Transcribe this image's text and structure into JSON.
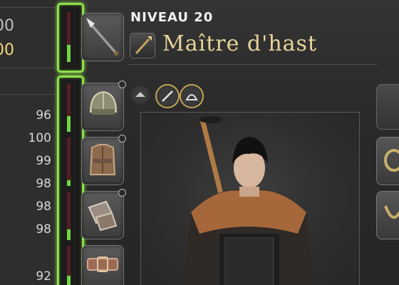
{
  "header": {
    "level_text": "NIVEAU 20",
    "job_name": "Maître d'hast"
  },
  "left_stats": {
    "partial_top": "00",
    "partial_bottom": "00",
    "item_levels": [
      "96",
      "100",
      "99",
      "98",
      "98",
      "98",
      "92"
    ]
  },
  "condition_bars": [
    {
      "slot": "main-hand",
      "level": 0.35
    },
    {
      "slot": "head",
      "level": 0.32
    },
    {
      "slot": "body",
      "level": 0.12
    },
    {
      "slot": "hands",
      "level": 0.22
    },
    {
      "slot": "waist",
      "level": 0.3
    }
  ],
  "slots": {
    "weapon": "spear-icon",
    "head": "helmet-icon",
    "body": "body-armor-icon",
    "hands": "gauntlets-icon",
    "waist": "belt-icon",
    "right_1": "earring-icon",
    "right_2": "necklace-icon",
    "right_top": "soul-crystal-icon"
  },
  "mini_icons": [
    "glamour-icon",
    "sword-icon",
    "gear-set-icon"
  ],
  "colors": {
    "condition_highlight": "#8de04a",
    "condition_fill": "#6fd83c",
    "condition_empty": "#551f22",
    "job_name": "#e9d49a",
    "mini_icon_ring": "#c2a35a"
  }
}
